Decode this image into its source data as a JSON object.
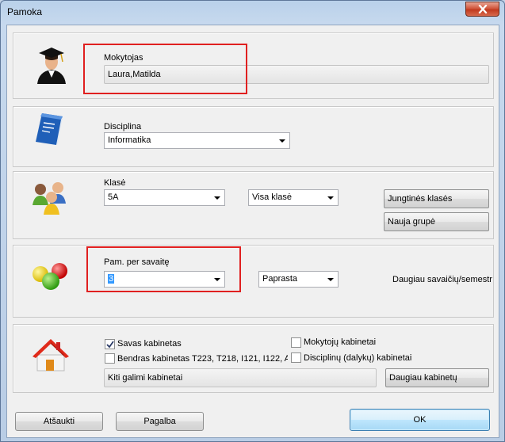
{
  "window": {
    "title": "Pamoka"
  },
  "teacher": {
    "label": "Mokytojas",
    "value": "Laura,Matilda"
  },
  "subject": {
    "label": "Disciplina",
    "value": "Informatika"
  },
  "klase": {
    "label": "Klasė",
    "class_value": "5A",
    "group_value": "Visa klasė",
    "joint_button": "Jungtinės klasės",
    "new_group_button": "Nauja grupė"
  },
  "lessons": {
    "label": "Pam. per savaitę",
    "value": "3",
    "mode_value": "Paprasta",
    "more_text": "Daugiau savaičių/semestr"
  },
  "rooms": {
    "own_room_label": "Savas kabinetas",
    "own_room_checked": true,
    "common_rooms_label": "Bendras kabinetas T223, T218, I121, I122, A",
    "common_rooms_checked": false,
    "teacher_rooms_label": "Mokytojų kabinetai",
    "teacher_rooms_checked": false,
    "subject_rooms_label": "Disciplinų (dalykų) kabinetai",
    "subject_rooms_checked": false,
    "other_rooms": "Kiti galimi kabinetai",
    "more_rooms_button": "Daugiau kabinetų"
  },
  "footer": {
    "cancel": "Atšaukti",
    "help": "Pagalba",
    "ok": "OK"
  }
}
